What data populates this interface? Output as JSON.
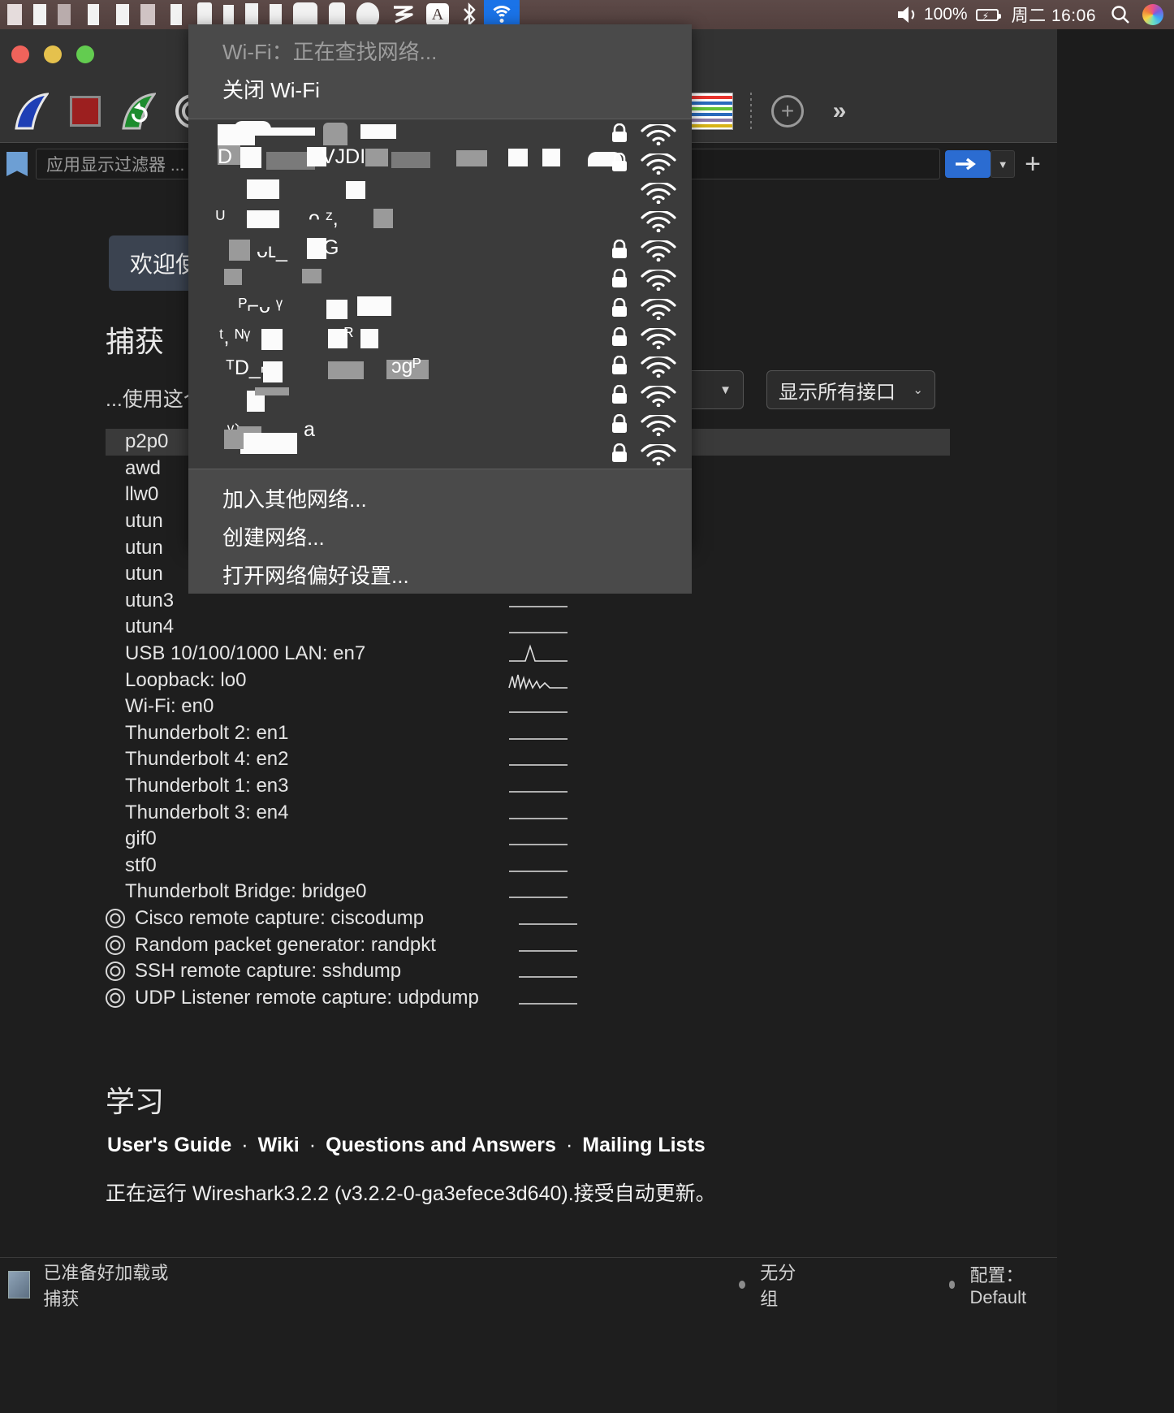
{
  "menubar": {
    "icons_left": [
      "redacted-app-icon",
      "redacted-app-icon",
      "redacted-app-icon",
      "redacted-app-icon",
      "redacted-app-icon",
      "redacted-app-icon",
      "redacted-app-icon",
      "redacted-app-icon",
      "redacted-app-icon",
      "redacted-app-icon",
      "redacted-app-icon",
      "redacted-app-icon",
      "redacted-app-icon",
      "redacted-app-icon"
    ],
    "shield_icon": "shield-icon",
    "zigzag_icon": "zigzag-icon",
    "input_source_label": "A",
    "bluetooth_icon": "bluetooth-icon",
    "wifi_icon": "wifi-icon",
    "volume_icon": "volume-icon",
    "battery_percent": "100%",
    "battery_icon": "battery-charging-icon",
    "datetime": "周二 16:06",
    "search_icon": "search-icon",
    "siri_icon": "siri-icon"
  },
  "wifi_menu": {
    "status_text": "Wi-Fi：正在查找网络...",
    "toggle_label": "关闭 Wi-Fi",
    "networks": [
      {
        "name": "",
        "secured": true,
        "redacted": true
      },
      {
        "name": "",
        "secured": true,
        "redacted": true
      },
      {
        "name": "",
        "secured": false,
        "redacted": true
      },
      {
        "name": "",
        "secured": false,
        "redacted": true
      },
      {
        "name": "",
        "secured": true,
        "redacted": true
      },
      {
        "name": "",
        "secured": true,
        "redacted": true
      },
      {
        "name": "",
        "secured": true,
        "redacted": true
      },
      {
        "name": "",
        "secured": true,
        "redacted": true
      },
      {
        "name": "",
        "secured": true,
        "redacted": true
      },
      {
        "name": "",
        "secured": true,
        "redacted": true
      },
      {
        "name": "",
        "secured": true,
        "redacted": true
      },
      {
        "name": "",
        "secured": true,
        "redacted": true
      }
    ],
    "actions": [
      "加入其他网络...",
      "创建网络...",
      "打开网络偏好设置..."
    ]
  },
  "wireshark": {
    "toolbar": {
      "start_capture": "start-capture-icon",
      "stop_capture": "stop-capture-icon",
      "restart_capture": "restart-capture-icon",
      "capture_options": "capture-options-icon",
      "go_up": "go-up-icon",
      "go_down": "go-down-icon",
      "auto_scroll": "auto-scroll-icon",
      "colorize": "colorize-icon",
      "zoom_in": "zoom-in-icon",
      "overflow": "»"
    },
    "filter": {
      "placeholder": "应用显示过滤器 ...",
      "value": "",
      "bookmark_icon": "bookmark-icon",
      "apply_icon": "arrow-right-icon",
      "caret_icon": "chevron-down-icon",
      "plus_icon": "plus-icon"
    },
    "welcome_badge": "欢迎使",
    "capture_title": "捕获",
    "capture_hint": "...使用这个",
    "iface_filter_value": "",
    "iface_show_all": "显示所有接口",
    "interfaces": [
      {
        "name": "p2p0",
        "selected": true,
        "has_gear": false,
        "spark": "flat"
      },
      {
        "name": "awd",
        "selected": false,
        "has_gear": false,
        "spark": "flat"
      },
      {
        "name": "llw0",
        "selected": false,
        "has_gear": false,
        "spark": "flat"
      },
      {
        "name": "utun",
        "selected": false,
        "has_gear": false,
        "spark": "flat"
      },
      {
        "name": "utun",
        "selected": false,
        "has_gear": false,
        "spark": "flat"
      },
      {
        "name": "utun",
        "selected": false,
        "has_gear": false,
        "spark": "flat"
      },
      {
        "name": "utun3",
        "selected": false,
        "has_gear": false,
        "spark": "flat"
      },
      {
        "name": "utun4",
        "selected": false,
        "has_gear": false,
        "spark": "flat"
      },
      {
        "name": "USB 10/100/1000 LAN: en7",
        "selected": false,
        "has_gear": false,
        "spark": "spike"
      },
      {
        "name": "Loopback: lo0",
        "selected": false,
        "has_gear": false,
        "spark": "busy"
      },
      {
        "name": "Wi-Fi: en0",
        "selected": false,
        "has_gear": false,
        "spark": "flat"
      },
      {
        "name": "Thunderbolt 2: en1",
        "selected": false,
        "has_gear": false,
        "spark": "flat"
      },
      {
        "name": "Thunderbolt 4: en2",
        "selected": false,
        "has_gear": false,
        "spark": "flat"
      },
      {
        "name": "Thunderbolt 1: en3",
        "selected": false,
        "has_gear": false,
        "spark": "flat"
      },
      {
        "name": "Thunderbolt 3: en4",
        "selected": false,
        "has_gear": false,
        "spark": "flat"
      },
      {
        "name": "gif0",
        "selected": false,
        "has_gear": false,
        "spark": "flat"
      },
      {
        "name": "stf0",
        "selected": false,
        "has_gear": false,
        "spark": "flat"
      },
      {
        "name": "Thunderbolt Bridge: bridge0",
        "selected": false,
        "has_gear": false,
        "spark": "flat"
      },
      {
        "name": "Cisco remote capture: ciscodump",
        "selected": false,
        "has_gear": true,
        "spark": "flat"
      },
      {
        "name": "Random packet generator: randpkt",
        "selected": false,
        "has_gear": true,
        "spark": "flat"
      },
      {
        "name": "SSH remote capture: sshdump",
        "selected": false,
        "has_gear": true,
        "spark": "flat"
      },
      {
        "name": "UDP Listener remote capture: udpdump",
        "selected": false,
        "has_gear": true,
        "spark": "flat"
      }
    ],
    "learn_title": "学习",
    "learn_links": [
      "User's Guide",
      "Wiki",
      "Questions and Answers",
      "Mailing Lists"
    ],
    "version_line": "正在运行 Wireshark3.2.2 (v3.2.2-0-ga3efece3d640).接受自动更新。",
    "statusbar": {
      "left_text": "已准备好加载或捕获",
      "middle_text": "无分组",
      "right_text": "配置：Default"
    }
  }
}
